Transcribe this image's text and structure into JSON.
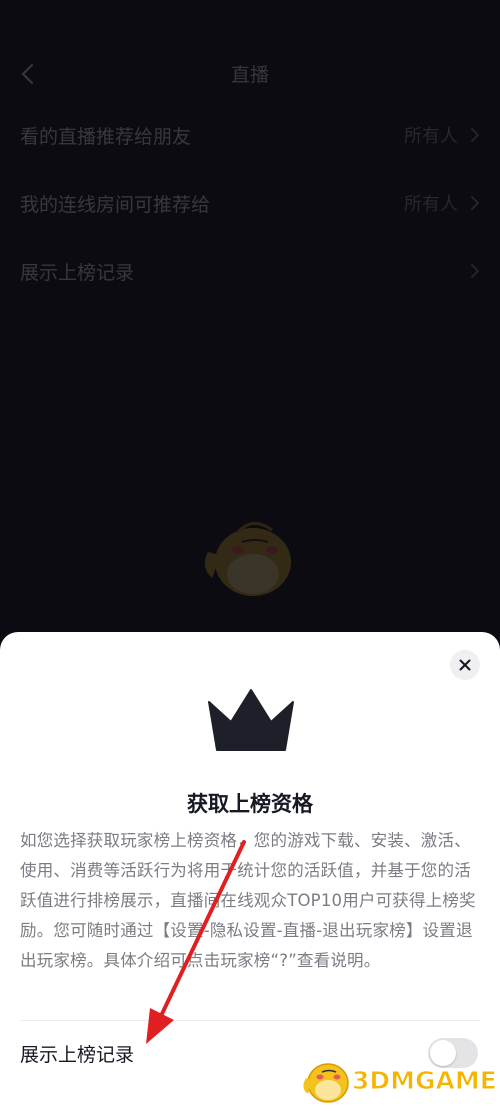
{
  "nav": {
    "title": "直播"
  },
  "settings": [
    {
      "label": "看的直播推荐给朋友",
      "value": "所有人"
    },
    {
      "label": "我的连线房间可推荐给",
      "value": "所有人"
    },
    {
      "label": "展示上榜记录",
      "value": ""
    }
  ],
  "sheet": {
    "title": "获取上榜资格",
    "description": "如您选择获取玩家榜上榜资格，您的游戏下载、安装、激活、使用、消费等活跃行为将用于统计您的活跃值，并基于您的活跃值进行排榜展示，直播间在线观众TOP10用户可获得上榜奖励。您可随时通过【设置-隐私设置-直播-退出玩家榜】设置退出玩家榜。具体介绍可点击玩家榜“?”查看说明。",
    "toggle_label": "展示上榜记录",
    "toggle_on": false
  },
  "watermark": {
    "text": "3DMGAME"
  },
  "colors": {
    "annotation_arrow": "#e02020",
    "brand": "#f4b400",
    "crown": "#1e2029"
  }
}
